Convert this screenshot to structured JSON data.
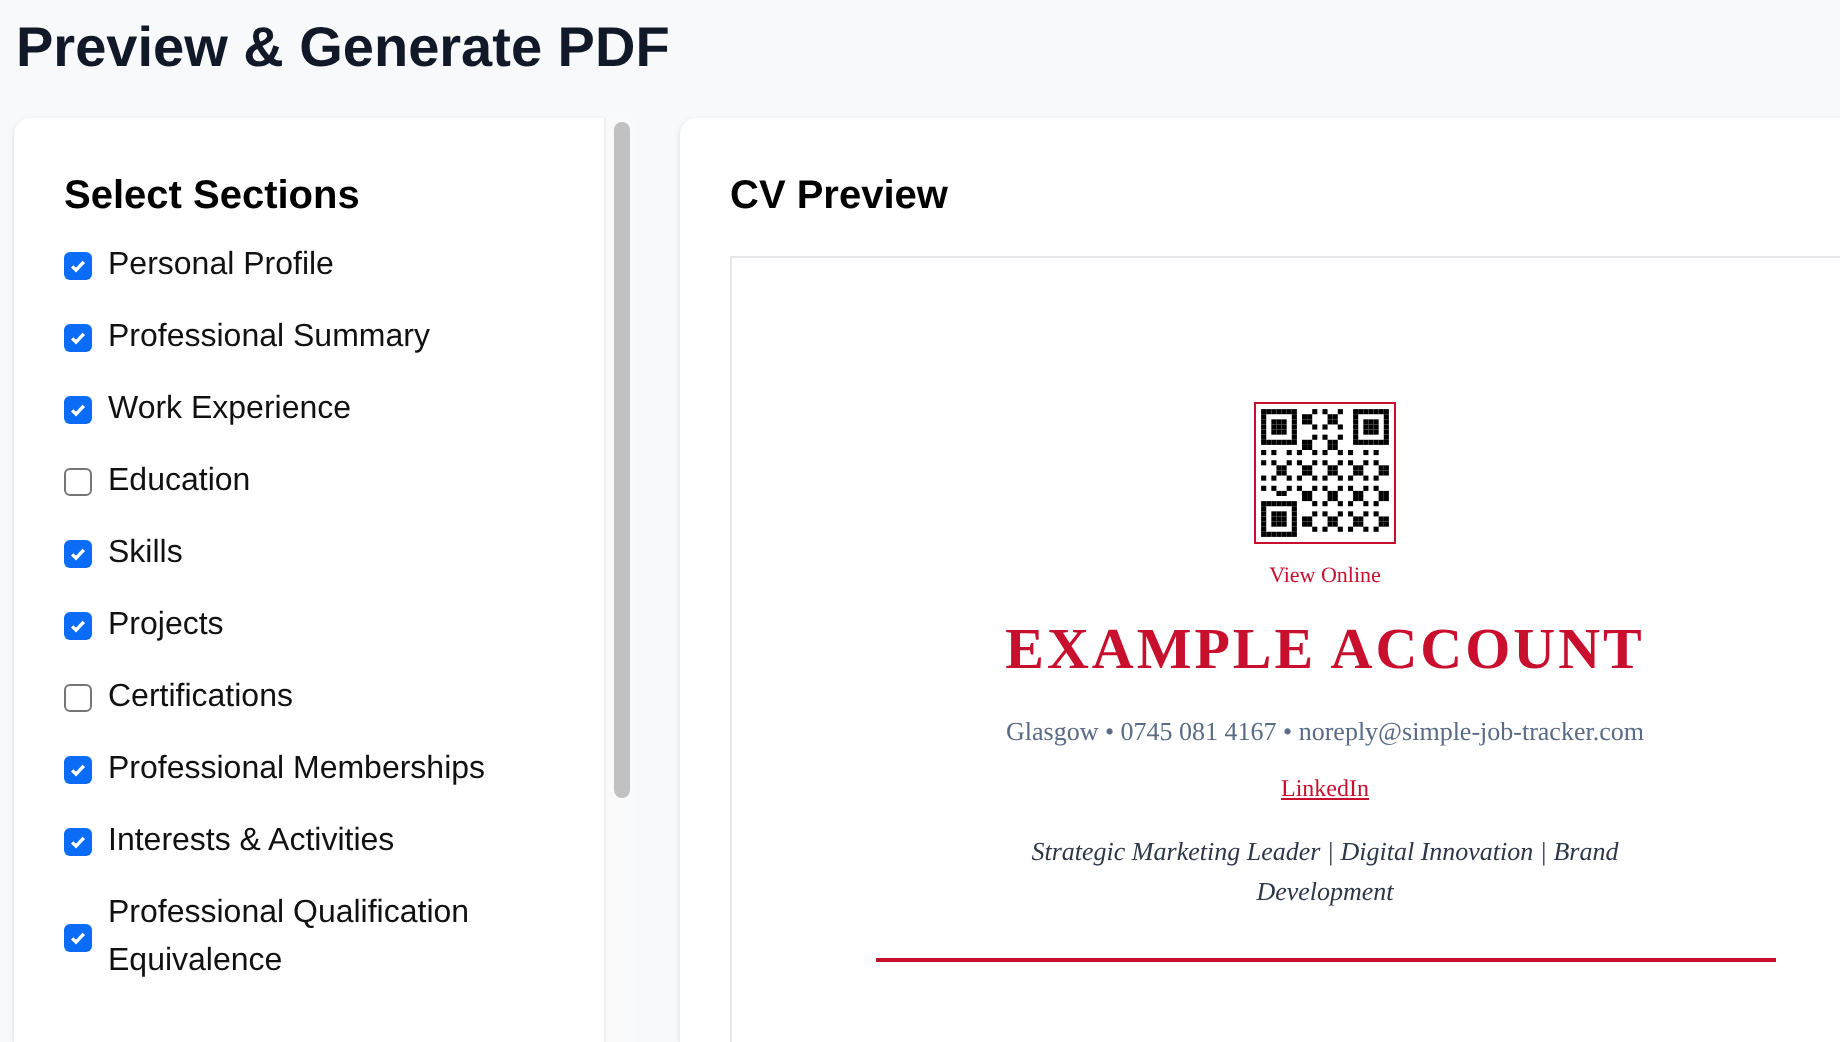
{
  "page_title": "Preview & Generate PDF",
  "sections_panel": {
    "title": "Select Sections",
    "items": [
      {
        "label": "Personal Profile",
        "checked": true
      },
      {
        "label": "Professional Summary",
        "checked": true
      },
      {
        "label": "Work Experience",
        "checked": true
      },
      {
        "label": "Education",
        "checked": false
      },
      {
        "label": "Skills",
        "checked": true
      },
      {
        "label": "Projects",
        "checked": true
      },
      {
        "label": "Certifications",
        "checked": false
      },
      {
        "label": "Professional Memberships",
        "checked": true
      },
      {
        "label": "Interests & Activities",
        "checked": true
      },
      {
        "label": "Professional Qualification Equivalence",
        "checked": true
      }
    ]
  },
  "preview": {
    "title": "CV Preview",
    "cv": {
      "qr_caption": "View Online",
      "name": "EXAMPLE ACCOUNT",
      "contact": "Glasgow • 0745 081 4167 • noreply@simple-job-tracker.com",
      "link": "LinkedIn",
      "tagline": "Strategic Marketing Leader | Digital Innovation | Brand Development"
    }
  }
}
